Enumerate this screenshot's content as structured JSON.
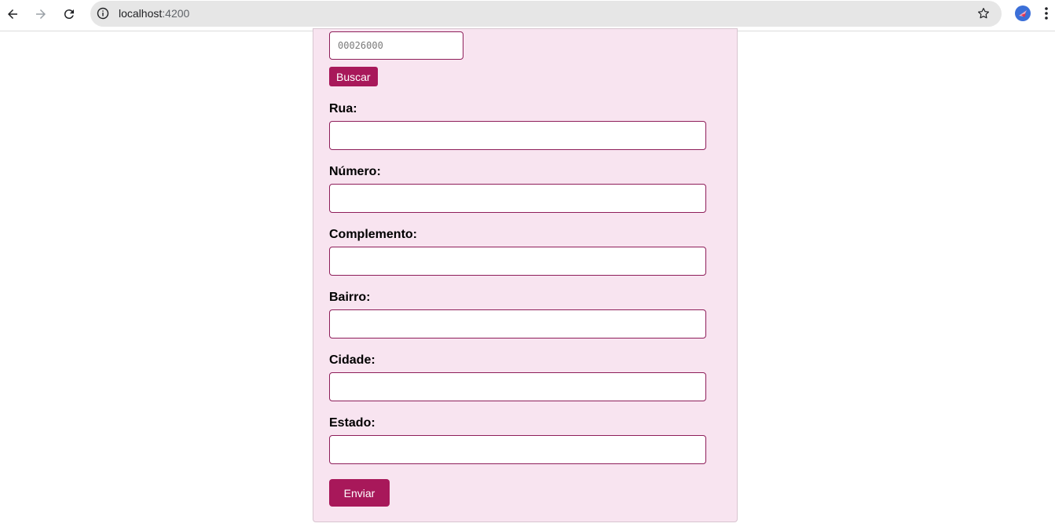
{
  "browser": {
    "url_host": "localhost",
    "url_port": ":4200"
  },
  "form": {
    "cep_placeholder": "00026000",
    "search_button": "Buscar",
    "fields": [
      {
        "label": "Rua:",
        "value": ""
      },
      {
        "label": "Número:",
        "value": ""
      },
      {
        "label": "Complemento:",
        "value": ""
      },
      {
        "label": "Bairro:",
        "value": ""
      },
      {
        "label": "Cidade:",
        "value": ""
      },
      {
        "label": "Estado:",
        "value": ""
      }
    ],
    "submit_button": "Enviar"
  },
  "colors": {
    "accent": "#a8185a",
    "card_background": "#f8e4f0",
    "input_border": "#8e1e5a"
  }
}
